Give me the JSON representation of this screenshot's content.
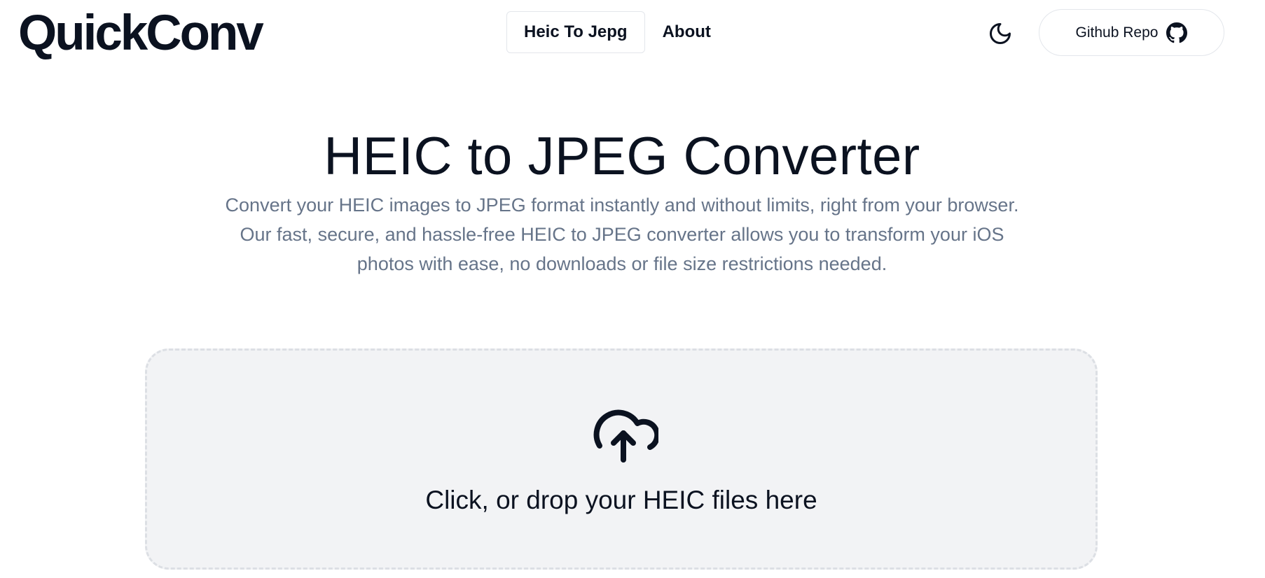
{
  "header": {
    "logo": "QuickConv",
    "nav": [
      {
        "label": "Heic To Jepg",
        "active": true
      },
      {
        "label": "About",
        "active": false
      }
    ],
    "theme_icon": "moon-icon",
    "github": {
      "label": "Github Repo",
      "icon": "github-icon"
    }
  },
  "hero": {
    "title": "HEIC to JPEG Converter",
    "description": "Convert your HEIC images to JPEG format instantly and without limits, right from your browser. Our fast, secure, and hassle-free HEIC to JPEG converter allows you to transform your iOS photos with ease, no downloads or file size restrictions needed."
  },
  "dropzone": {
    "icon": "cloud-upload-icon",
    "text": "Click, or drop your HEIC files here"
  },
  "colors": {
    "text": "#0b1220",
    "muted": "#667489",
    "dropzone_bg": "#f2f3f5",
    "border": "#e3e6eb"
  }
}
